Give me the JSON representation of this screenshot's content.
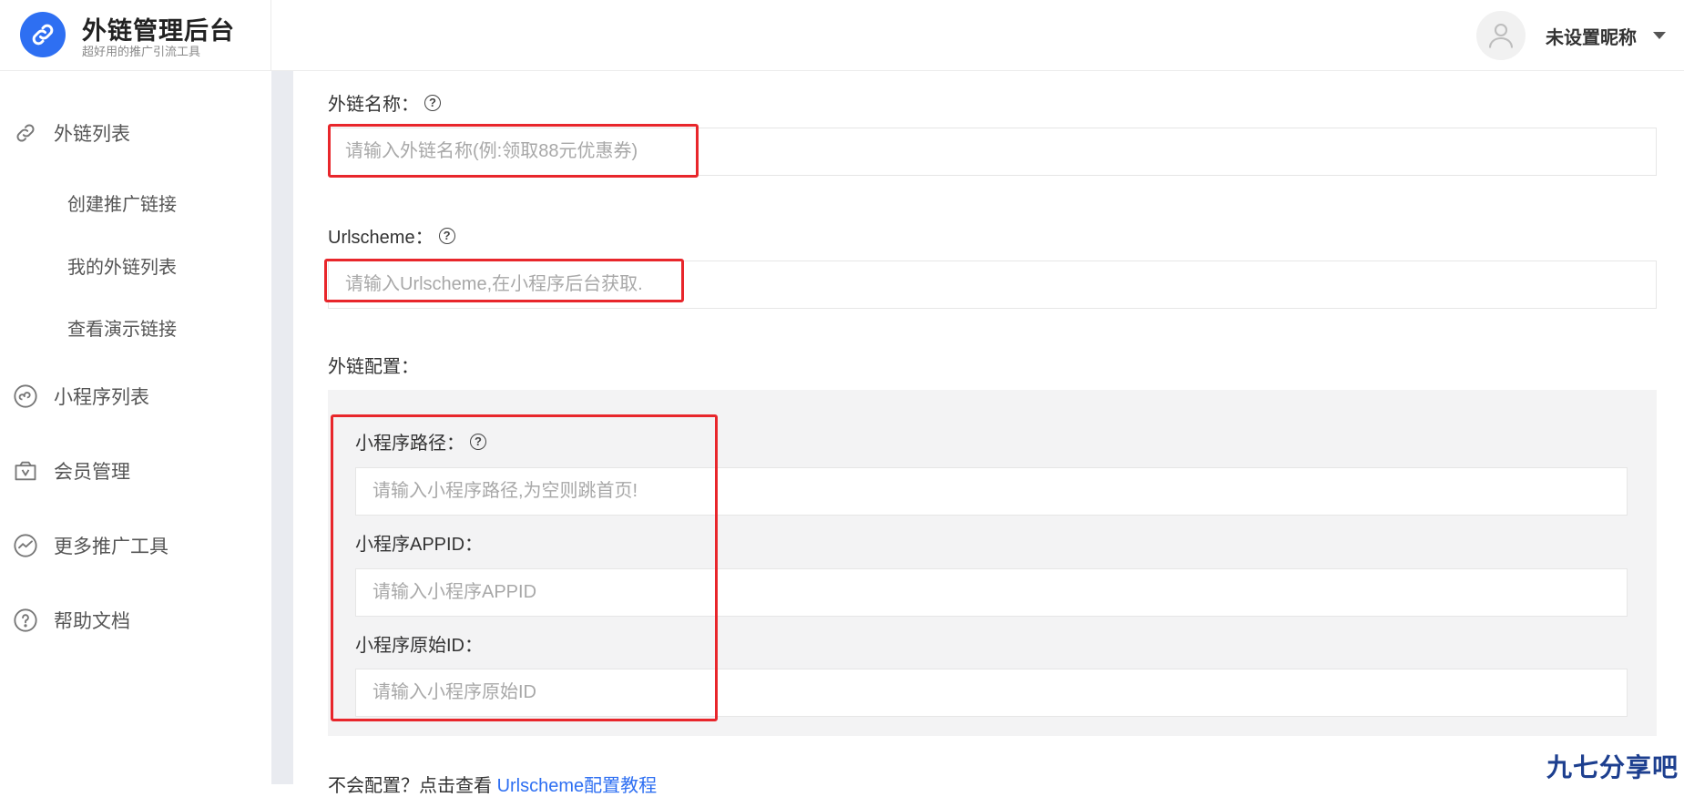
{
  "brand": {
    "title": "外链管理后台",
    "subtitle": "超好用的推广引流工具"
  },
  "header": {
    "nickname": "未设置昵称"
  },
  "sidebar": {
    "items": [
      {
        "label": "外链列表",
        "icon": "link-icon"
      },
      {
        "label": "小程序列表",
        "icon": "miniprogram-icon"
      },
      {
        "label": "会员管理",
        "icon": "vip-bag-icon"
      },
      {
        "label": "更多推广工具",
        "icon": "trend-icon"
      },
      {
        "label": "帮助文档",
        "icon": "question-icon"
      }
    ],
    "sub_items": [
      "创建推广链接",
      "我的外链列表",
      "查看演示链接"
    ]
  },
  "form": {
    "name_label": "外链名称：",
    "name_placeholder": "请输入外链名称(例:领取88元优惠券)",
    "scheme_label": "Urlscheme：",
    "scheme_placeholder": "请输入Urlscheme,在小程序后台获取.",
    "config_label": "外链配置：",
    "path_label": "小程序路径：",
    "path_placeholder": "请输入小程序路径,为空则跳首页!",
    "appid_label": "小程序APPID：",
    "appid_placeholder": "请输入小程序APPID",
    "origin_label": "小程序原始ID：",
    "origin_placeholder": "请输入小程序原始ID"
  },
  "footer": {
    "prefix": "不会配置？点击查看 ",
    "link": "Urlscheme配置教程"
  },
  "watermark": "九七分享吧",
  "colors": {
    "accent": "#2e6ff2",
    "highlight": "#e8262b"
  }
}
